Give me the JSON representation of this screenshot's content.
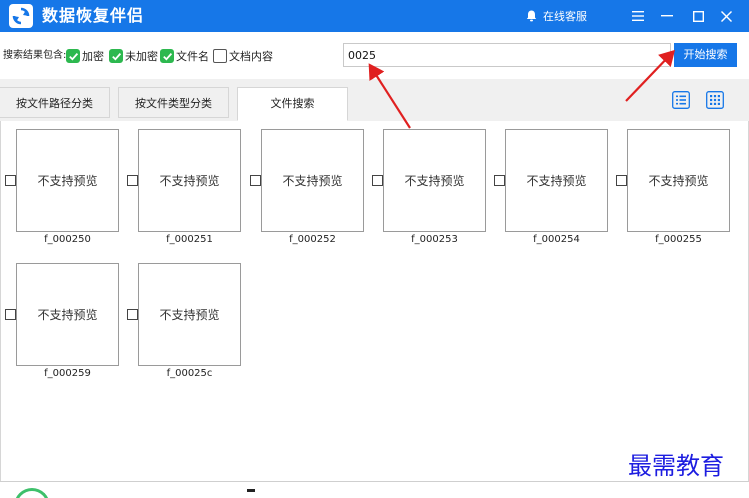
{
  "app": {
    "title": "数据恢复伴侣"
  },
  "titlebar": {
    "service_label": "在线客服"
  },
  "filters": {
    "caption": "搜索结果包含:",
    "options": [
      {
        "label": "加密",
        "checked": true
      },
      {
        "label": "未加密",
        "checked": true
      },
      {
        "label": "文件名",
        "checked": true
      },
      {
        "label": "文档内容",
        "checked": false
      }
    ]
  },
  "search": {
    "value": "0025",
    "button_label": "开始搜索"
  },
  "tabs": [
    {
      "label": "按文件路径分类",
      "active": false
    },
    {
      "label": "按文件类型分类",
      "active": false
    },
    {
      "label": "文件搜索",
      "active": true
    }
  ],
  "files": {
    "preview_text": "不支持预览",
    "items": [
      {
        "name": "f_000250"
      },
      {
        "name": "f_000251"
      },
      {
        "name": "f_000252"
      },
      {
        "name": "f_000253"
      },
      {
        "name": "f_000254"
      },
      {
        "name": "f_000255"
      },
      {
        "name": "f_000259"
      },
      {
        "name": "f_00025c"
      }
    ]
  },
  "watermark": {
    "text": "最需教育"
  },
  "colors": {
    "accent": "#1677e8",
    "check": "#2db84f",
    "annotation": "#e02020"
  }
}
